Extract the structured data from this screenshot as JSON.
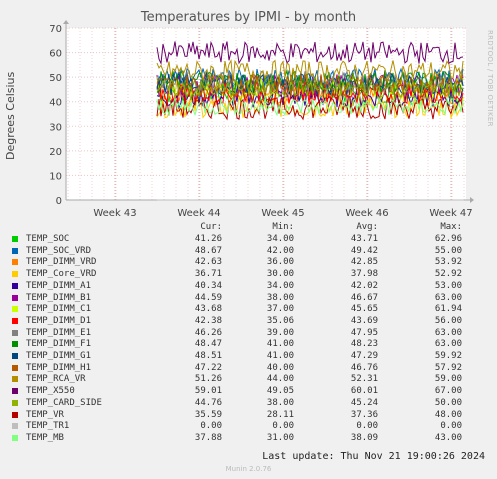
{
  "chart_data": {
    "type": "line",
    "title": "Temperatures by IPMI - by month",
    "ylabel": "Degrees Celsius",
    "ylim": [
      0,
      70
    ],
    "y_ticks": [
      "0",
      "10",
      "20",
      "30",
      "40",
      "50",
      "60",
      "70"
    ],
    "x_ticks": [
      "Week 43",
      "Week 44",
      "Week 45",
      "Week 46",
      "Week 47"
    ],
    "grid": true,
    "columns": [
      "Cur:",
      "Min:",
      "Avg:",
      "Max:"
    ],
    "series": [
      {
        "name": "TEMP_SOC",
        "color": "#00cc00",
        "cur": "41.26",
        "min": "34.00",
        "avg": "43.71",
        "max": "62.96"
      },
      {
        "name": "TEMP_SOC_VRD",
        "color": "#0066b3",
        "cur": "48.67",
        "min": "42.00",
        "avg": "49.42",
        "max": "55.00"
      },
      {
        "name": "TEMP_DIMM_VRD",
        "color": "#ff8000",
        "cur": "42.63",
        "min": "36.00",
        "avg": "42.85",
        "max": "53.92"
      },
      {
        "name": "TEMP_Core_VRD",
        "color": "#ffcc00",
        "cur": "36.71",
        "min": "30.00",
        "avg": "37.98",
        "max": "52.92"
      },
      {
        "name": "TEMP_DIMM_A1",
        "color": "#330099",
        "cur": "40.34",
        "min": "34.00",
        "avg": "42.02",
        "max": "53.00"
      },
      {
        "name": "TEMP_DIMM_B1",
        "color": "#990099",
        "cur": "44.59",
        "min": "38.00",
        "avg": "46.67",
        "max": "63.00"
      },
      {
        "name": "TEMP_DIMM_C1",
        "color": "#ccff00",
        "cur": "43.68",
        "min": "37.00",
        "avg": "45.65",
        "max": "61.94"
      },
      {
        "name": "TEMP_DIMM_D1",
        "color": "#ff0000",
        "cur": "42.38",
        "min": "35.06",
        "avg": "43.69",
        "max": "56.00"
      },
      {
        "name": "TEMP_DIMM_E1",
        "color": "#808080",
        "cur": "46.26",
        "min": "39.00",
        "avg": "47.95",
        "max": "63.00"
      },
      {
        "name": "TEMP_DIMM_F1",
        "color": "#008f00",
        "cur": "48.47",
        "min": "41.00",
        "avg": "48.23",
        "max": "63.00"
      },
      {
        "name": "TEMP_DIMM_G1",
        "color": "#00487d",
        "cur": "48.51",
        "min": "41.00",
        "avg": "47.29",
        "max": "59.92"
      },
      {
        "name": "TEMP_DIMM_H1",
        "color": "#b35a00",
        "cur": "47.22",
        "min": "40.00",
        "avg": "46.76",
        "max": "57.92"
      },
      {
        "name": "TEMP_RCA_VR",
        "color": "#b38f00",
        "cur": "51.26",
        "min": "44.00",
        "avg": "52.31",
        "max": "59.00"
      },
      {
        "name": "TEMP_X550",
        "color": "#6b006b",
        "cur": "59.01",
        "min": "49.05",
        "avg": "60.01",
        "max": "67.00"
      },
      {
        "name": "TEMP_CARD_SIDE",
        "color": "#8fb300",
        "cur": "44.76",
        "min": "38.00",
        "avg": "45.24",
        "max": "50.00"
      },
      {
        "name": "TEMP_VR",
        "color": "#b30000",
        "cur": "35.59",
        "min": "28.11",
        "avg": "37.36",
        "max": "48.00"
      },
      {
        "name": "TEMP_TR1",
        "color": "#bebebe",
        "cur": "0.00",
        "min": "0.00",
        "avg": "0.00",
        "max": "0.00"
      },
      {
        "name": "TEMP_MB",
        "color": "#80ff80",
        "cur": "37.88",
        "min": "31.00",
        "avg": "38.09",
        "max": "43.00"
      }
    ]
  },
  "watermark": "RRDTOOL / TOBI OETIKER",
  "last_update": "Last update: Thu Nov 21 19:00:26 2024",
  "footer": "Munin 2.0.76"
}
